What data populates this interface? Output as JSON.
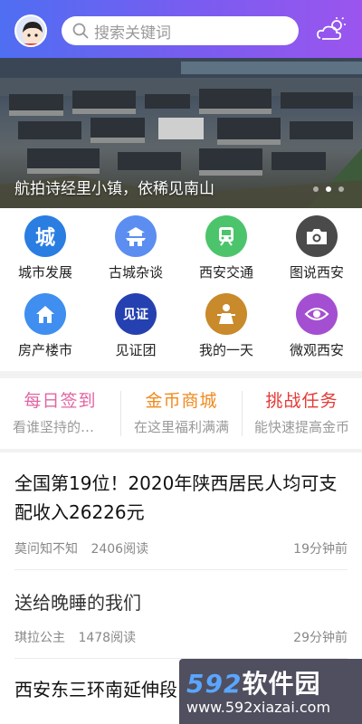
{
  "header": {
    "search_placeholder": "搜索关键词",
    "avatar_icon": "avatar-icon",
    "weather_icon": "weather-icon"
  },
  "banner": {
    "caption": "航拍诗经里小镇，依稀见南山",
    "slides": 3,
    "active_slide": 2
  },
  "grid": [
    {
      "label": "城市发展",
      "icon": "city-icon",
      "glyph": "城",
      "color": "#2a7de1"
    },
    {
      "label": "古城杂谈",
      "icon": "pagoda-icon",
      "glyph": "",
      "color": "#5b8ef0"
    },
    {
      "label": "西安交通",
      "icon": "train-icon",
      "glyph": "",
      "color": "#4cc46b"
    },
    {
      "label": "图说西安",
      "icon": "camera-icon",
      "glyph": "",
      "color": "#4a4a4a"
    },
    {
      "label": "房产楼市",
      "icon": "house-icon",
      "glyph": "",
      "color": "#3f8ef0"
    },
    {
      "label": "见证团",
      "icon": "witness-icon",
      "glyph": "见证",
      "color": "#2540b0"
    },
    {
      "label": "我的一天",
      "icon": "person-icon",
      "glyph": "",
      "color": "#c88a2a"
    },
    {
      "label": "微观西安",
      "icon": "eye-icon",
      "glyph": "",
      "color": "#a44fd1"
    }
  ],
  "actions": [
    {
      "title": "每日签到",
      "sub": "看谁坚持的时间最长",
      "color": "#e264a3"
    },
    {
      "title": "金币商城",
      "sub": "在这里福利满满",
      "color": "#f08a1f"
    },
    {
      "title": "挑战任务",
      "sub": "能快速提高金币",
      "color": "#e53935"
    }
  ],
  "feed": [
    {
      "title": "全国第19位！2020年陕西居民人均可支配收入26226元",
      "author": "莫问知不知",
      "reads": "2406阅读",
      "time": "19分钟前"
    },
    {
      "title": "送给晚睡的我们",
      "author": "琪拉公主",
      "reads": "1478阅读",
      "time": "29分钟前"
    },
    {
      "title": "西安东三环南延伸段",
      "author": "",
      "reads": "",
      "time": ""
    }
  ],
  "watermark": {
    "brand_num": "592",
    "brand_text": "软件园",
    "url": "www.592xiazai.com"
  }
}
